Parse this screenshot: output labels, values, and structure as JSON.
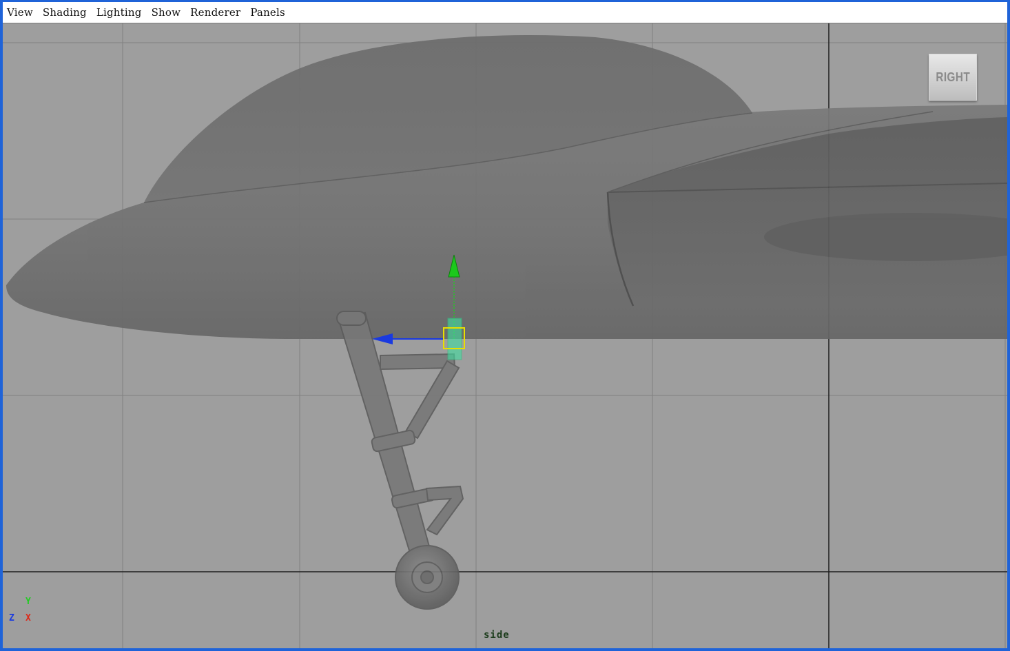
{
  "menubar": {
    "items": [
      "View",
      "Shading",
      "Lighting",
      "Show",
      "Renderer",
      "Panels"
    ]
  },
  "viewport": {
    "camera_label": "side",
    "viewcube_label": "RIGHT",
    "axis_indicator": {
      "y": "Y",
      "z": "Z",
      "x": "X"
    }
  },
  "colors": {
    "window_border": "#1f63d8",
    "viewport_bg": "#9e9e9e",
    "grid_line": "#7f7f7f",
    "grid_axis": "#1e1e1e",
    "model_gray": "#6f6f6f",
    "manip_y": "#22cc22",
    "manip_z": "#1a3ae0",
    "manip_center": "#e8e000",
    "selected_joint": "#40e0a0"
  }
}
